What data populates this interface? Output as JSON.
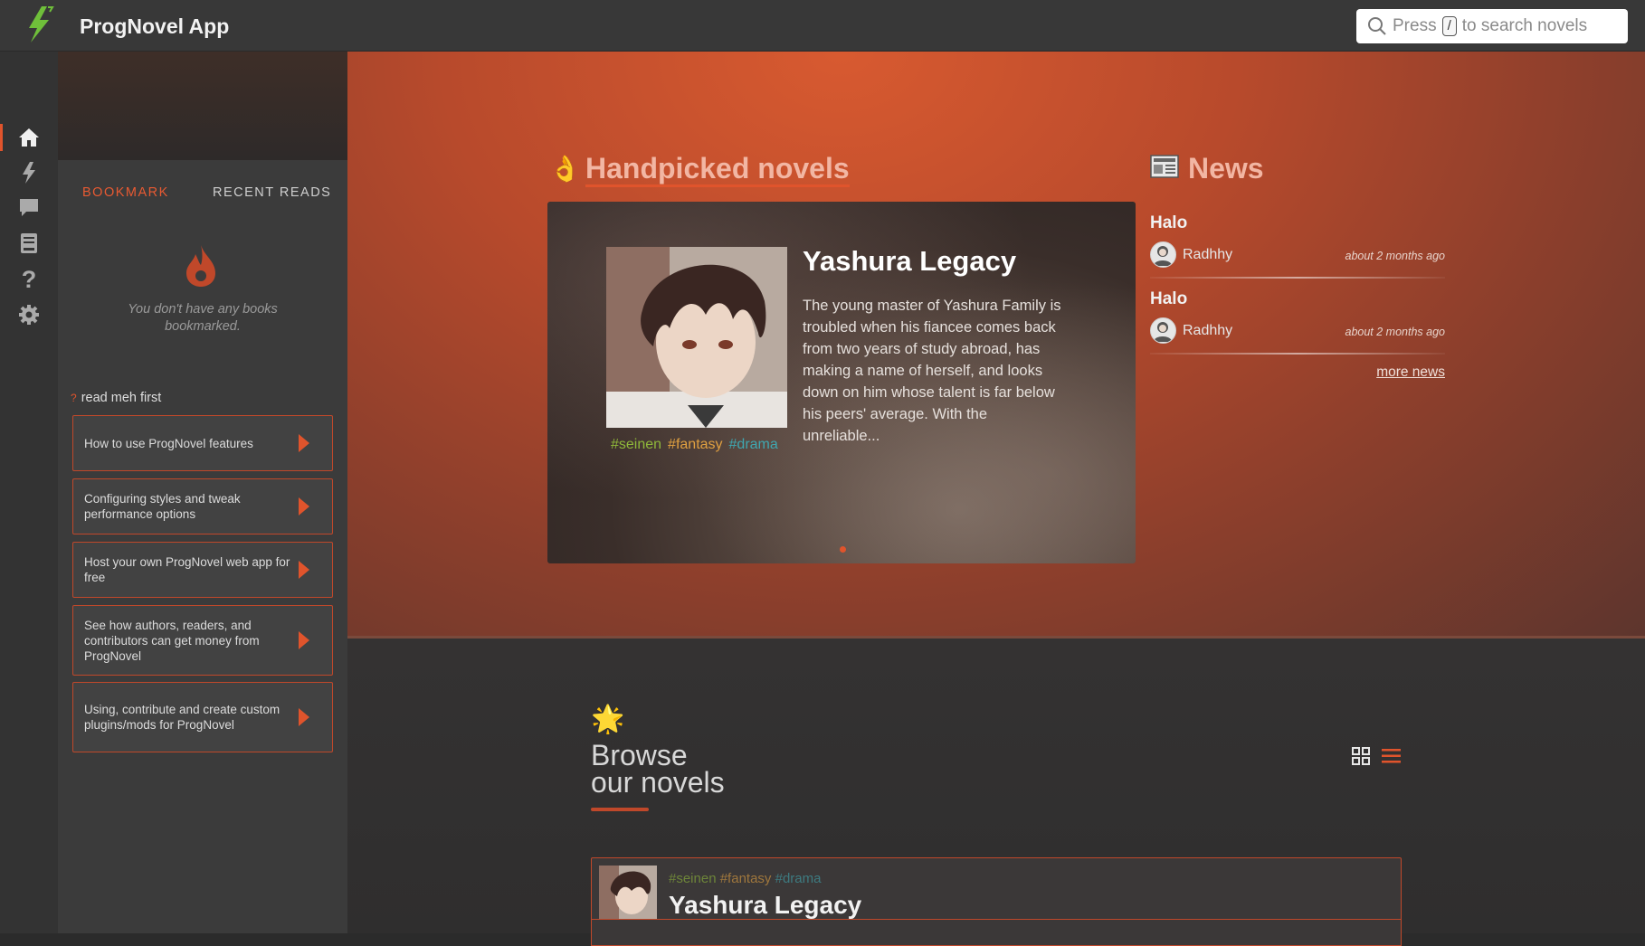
{
  "app": {
    "title": "ProgNovel App"
  },
  "search": {
    "prefix": "Press",
    "key": "/",
    "suffix": "to search novels"
  },
  "sidebar": {
    "rail": [
      "home-icon",
      "lightning-icon",
      "chat-icon",
      "book-icon",
      "help-icon",
      "gear-icon"
    ],
    "tabs": {
      "bookmark": "BOOKMARK",
      "recent": "RECENT READS"
    },
    "empty_text": "You don't have any books bookmarked.",
    "readme_label": "read meh first",
    "guides": [
      "How to use ProgNovel features",
      "Configuring styles and tweak performance options",
      "Host your own ProgNovel web app for free",
      "See how authors, readers, and contributors can get money from ProgNovel",
      "Using, contribute and create custom plugins/mods for ProgNovel"
    ]
  },
  "handpicked": {
    "heading": "Handpicked novels",
    "emoji": "👌",
    "novel": {
      "title": "Yashura Legacy",
      "description": "The young master of Yashura Family is troubled when his fiancee comes back from two years of study abroad, has making a name of herself, and looks down on him whose talent is far below his peers' average. With the unreliable...",
      "tags": [
        "#seinen",
        "#fantasy",
        "#drama"
      ]
    }
  },
  "news": {
    "heading": "News",
    "items": [
      {
        "title": "Halo",
        "author": "Radhhy",
        "time": "about 2 months ago"
      },
      {
        "title": "Halo",
        "author": "Radhhy",
        "time": "about 2 months ago"
      }
    ],
    "more": "more news"
  },
  "browse": {
    "emoji": "🌟",
    "title_line1": "Browse",
    "title_line2": "our novels",
    "rows": [
      {
        "title": "Yashura Legacy",
        "tags": [
          "#seinen",
          "#fantasy",
          "#drama"
        ]
      }
    ]
  },
  "colors": {
    "accent": "#e0542c",
    "seinen": "#8fb83a",
    "fantasy": "#e0a040",
    "drama": "#3fa7b0"
  }
}
